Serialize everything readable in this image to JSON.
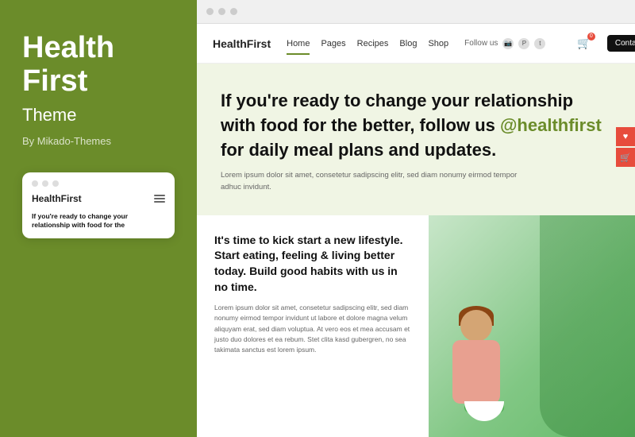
{
  "sidebar": {
    "title_line1": "Health",
    "title_line2": "First",
    "subtitle": "Theme",
    "author": "By Mikado-Themes",
    "preview_logo": "HealthFirst",
    "preview_body_text": "If you're ready to change your relationship with food for the"
  },
  "browser": {
    "dots": [
      "dot1",
      "dot2",
      "dot3"
    ]
  },
  "header": {
    "logo": "HealthFirst",
    "nav": [
      "Home",
      "Pages",
      "Recipes",
      "Blog",
      "Shop"
    ],
    "follow_label": "Follow us",
    "contact_label": "Contact us",
    "cart_badge": "0"
  },
  "hero": {
    "text_before": "If you're ready to change your relationship with food for the better, follow us ",
    "handle": "@healthfirst",
    "text_after": " for daily meal plans and updates.",
    "subtitle": "Lorem ipsum dolor sit amet, consetetur sadipscing elitr, sed diam nonumy eirmod tempor adhuc invidunt."
  },
  "bottom": {
    "heading": "It's time to kick start a new lifestyle. Start eating, feeling & living better today. Build good habits with us in no time.",
    "para": "Lorem ipsum dolor sit amet, consetetur sadipscing elitr, sed diam nonumy eirmod tempor invidunt ut labore et dolore magna velum aliquyam erat, sed diam voluptua. At vero eos et mea accusam et justo duo dolores et ea rebum. Stet clita kasd gubergren, no sea takimata sanctus est lorem ipsum."
  }
}
